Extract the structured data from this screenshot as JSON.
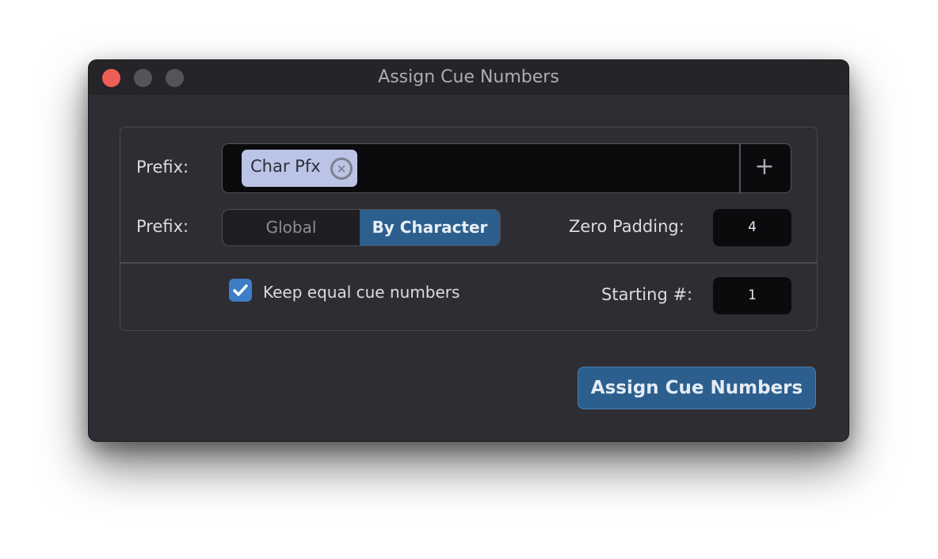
{
  "window": {
    "title": "Assign Cue Numbers",
    "controls": [
      "close",
      "minimize",
      "zoom"
    ]
  },
  "form": {
    "prefix_label": "Prefix:",
    "prefix_tokens": [
      {
        "label": "Char Pfx",
        "remove_icon": "circle-x-icon"
      }
    ],
    "add_icon": "+",
    "mode_label": "Prefix:",
    "mode_options": [
      "Global",
      "By Character"
    ],
    "mode_selected": "By Character",
    "zero_padding_label": "Zero Padding:",
    "zero_padding_value": "4",
    "keep_equal_label": "Keep equal cue numbers",
    "keep_equal_checked": true,
    "starting_label": "Starting #:",
    "starting_value": "1"
  },
  "actions": {
    "assign_label": "Assign Cue Numbers"
  },
  "colors": {
    "accent": "#2c5f8d",
    "checkbox": "#3d7ec6",
    "token_bg": "#b9c4e6",
    "close": "#ee5f57"
  }
}
